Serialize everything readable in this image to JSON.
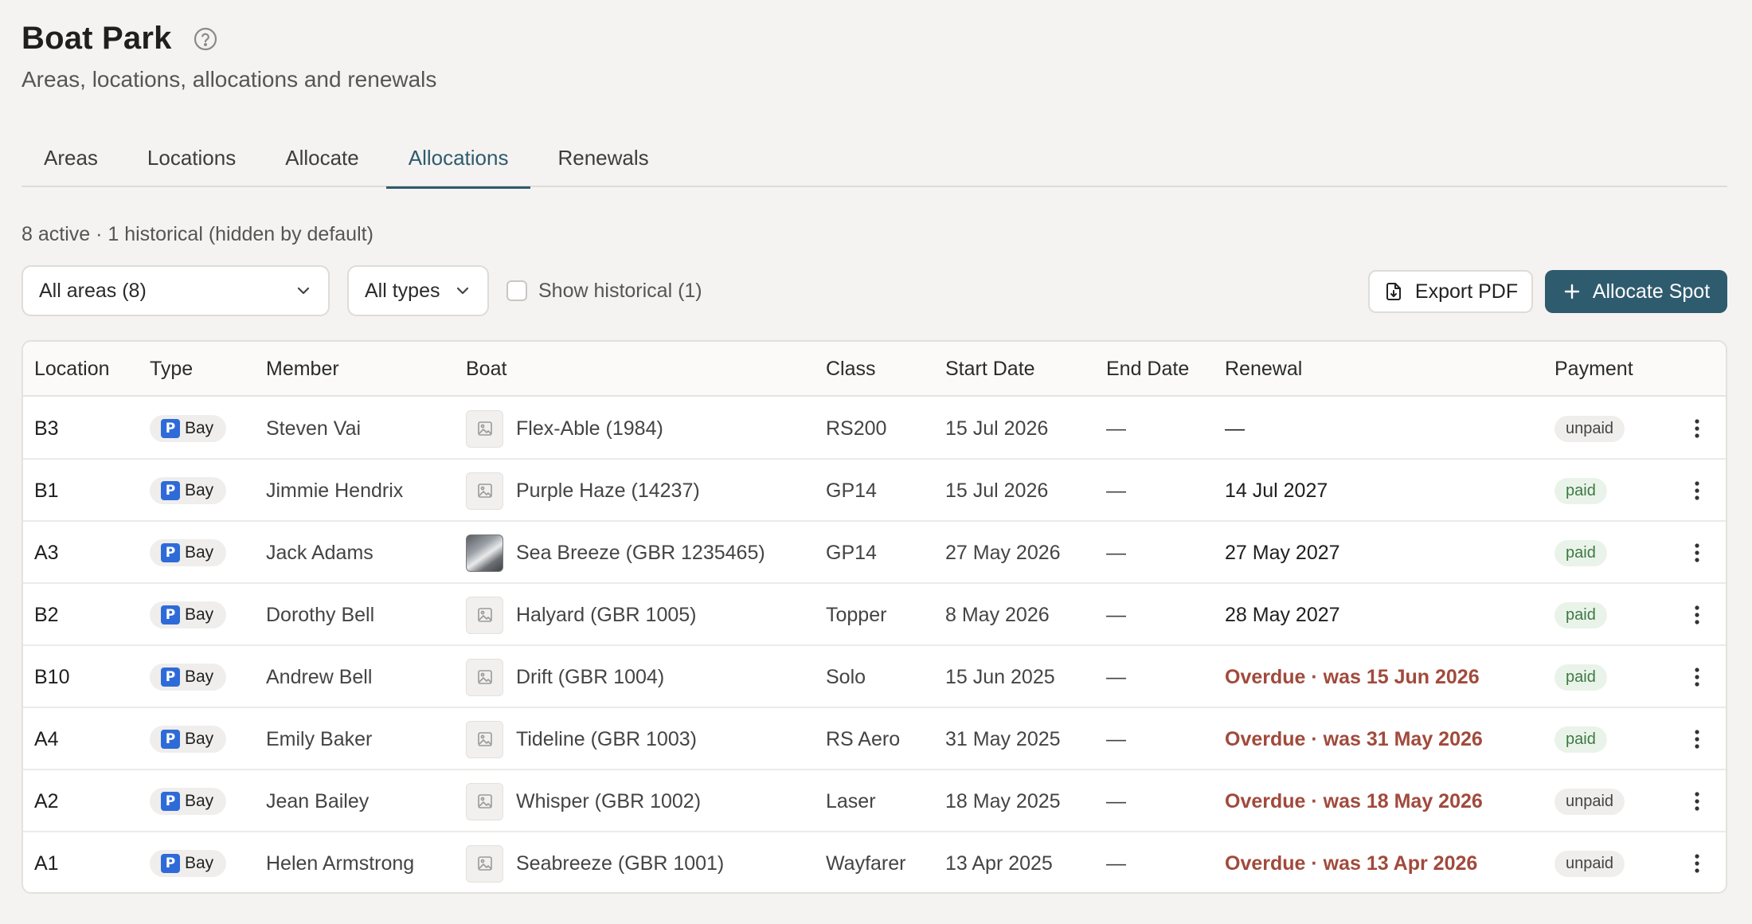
{
  "header": {
    "title": "Boat Park",
    "subtitle": "Areas, locations, allocations and renewals",
    "help_icon": "help-circle-icon"
  },
  "tabs": [
    {
      "label": "Areas",
      "active": false
    },
    {
      "label": "Locations",
      "active": false
    },
    {
      "label": "Allocate",
      "active": false
    },
    {
      "label": "Allocations",
      "active": true
    },
    {
      "label": "Renewals",
      "active": false
    }
  ],
  "summary": "8 active · 1 historical (hidden by default)",
  "filters": {
    "areas": "All areas (8)",
    "types": "All types",
    "show_historical": "Show historical (1)",
    "show_historical_checked": false
  },
  "actions": {
    "export_label": "Export PDF",
    "allocate_label": "Allocate Spot"
  },
  "colors": {
    "accent": "#2f5b6e",
    "overdue": "#a14a3c",
    "paid_text": "#3c7a43",
    "parking_icon": "#2e6bd8"
  },
  "table": {
    "columns": [
      "Location",
      "Type",
      "Member",
      "Boat",
      "Class",
      "Start Date",
      "End Date",
      "Renewal",
      "Payment"
    ],
    "rows": [
      {
        "location": "B3",
        "type": "Bay",
        "member": "Steven Vai",
        "boat": "Flex-Able (1984)",
        "has_photo": false,
        "class": "RS200",
        "start": "15 Jul 2026",
        "end": "—",
        "renewal": "—",
        "overdue": false,
        "payment": "unpaid"
      },
      {
        "location": "B1",
        "type": "Bay",
        "member": "Jimmie Hendrix",
        "boat": "Purple Haze (14237)",
        "has_photo": false,
        "class": "GP14",
        "start": "15 Jul 2026",
        "end": "—",
        "renewal": "14 Jul 2027",
        "overdue": false,
        "payment": "paid"
      },
      {
        "location": "A3",
        "type": "Bay",
        "member": "Jack Adams",
        "boat": "Sea Breeze (GBR 1235465)",
        "has_photo": true,
        "class": "GP14",
        "start": "27 May 2026",
        "end": "—",
        "renewal": "27 May 2027",
        "overdue": false,
        "payment": "paid"
      },
      {
        "location": "B2",
        "type": "Bay",
        "member": "Dorothy Bell",
        "boat": "Halyard (GBR 1005)",
        "has_photo": false,
        "class": "Topper",
        "start": "8 May 2026",
        "end": "—",
        "renewal": "28 May 2027",
        "overdue": false,
        "payment": "paid"
      },
      {
        "location": "B10",
        "type": "Bay",
        "member": "Andrew Bell",
        "boat": "Drift (GBR 1004)",
        "has_photo": false,
        "class": "Solo",
        "start": "15 Jun 2025",
        "end": "—",
        "renewal": "Overdue · was 15 Jun 2026",
        "overdue": true,
        "payment": "paid"
      },
      {
        "location": "A4",
        "type": "Bay",
        "member": "Emily Baker",
        "boat": "Tideline (GBR 1003)",
        "has_photo": false,
        "class": "RS Aero",
        "start": "31 May 2025",
        "end": "—",
        "renewal": "Overdue · was 31 May 2026",
        "overdue": true,
        "payment": "paid"
      },
      {
        "location": "A2",
        "type": "Bay",
        "member": "Jean Bailey",
        "boat": "Whisper (GBR 1002)",
        "has_photo": false,
        "class": "Laser",
        "start": "18 May 2025",
        "end": "—",
        "renewal": "Overdue · was 18 May 2026",
        "overdue": true,
        "payment": "unpaid"
      },
      {
        "location": "A1",
        "type": "Bay",
        "member": "Helen Armstrong",
        "boat": "Seabreeze (GBR 1001)",
        "has_photo": false,
        "class": "Wayfarer",
        "start": "13 Apr 2025",
        "end": "—",
        "renewal": "Overdue · was 13 Apr 2026",
        "overdue": true,
        "payment": "unpaid"
      }
    ]
  }
}
